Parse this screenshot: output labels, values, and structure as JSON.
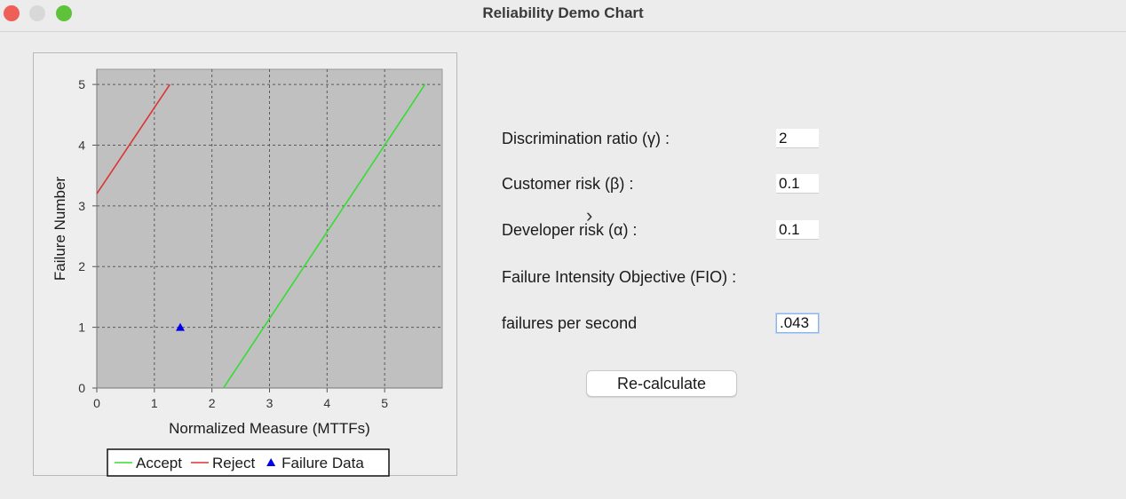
{
  "window": {
    "title": "Reliability Demo Chart"
  },
  "form": {
    "discrimination_label": "Discrimination ratio (γ) :",
    "discrimination_value": "2",
    "customer_risk_label": "Customer risk (β) :",
    "customer_risk_value": "0.1",
    "developer_risk_label": "Developer risk (α) :",
    "developer_risk_value": "0.1",
    "fio_label": "Failure Intensity Objective (FIO) :",
    "failures_label": "failures per second",
    "failures_value": ".043",
    "recalc_label": "Re-calculate"
  },
  "icons": {
    "cursor": "mouse-pointer"
  },
  "colors": {
    "accept": "#33dd33",
    "reject": "#dd3333",
    "failure": "#0000ee",
    "plot_bg": "#c0c0c0"
  },
  "chart_data": {
    "type": "line",
    "title": "",
    "xlabel": "Normalized Measure (MTTFs)",
    "ylabel": "Failure Number",
    "xlim": [
      0,
      6
    ],
    "ylim": [
      0,
      5.25
    ],
    "xticks": [
      0,
      1,
      2,
      3,
      4,
      5
    ],
    "yticks": [
      0,
      1,
      2,
      3,
      4,
      5
    ],
    "grid": true,
    "legend_position": "bottom",
    "series": [
      {
        "name": "Accept",
        "marker": "line",
        "x": [
          2.2,
          5.7
        ],
        "y": [
          0,
          5
        ]
      },
      {
        "name": "Reject",
        "marker": "line",
        "x": [
          0,
          1.27
        ],
        "y": [
          3.2,
          5
        ]
      },
      {
        "name": "Failure Data",
        "marker": "triangle",
        "x": [
          1.45
        ],
        "y": [
          1
        ]
      }
    ]
  }
}
